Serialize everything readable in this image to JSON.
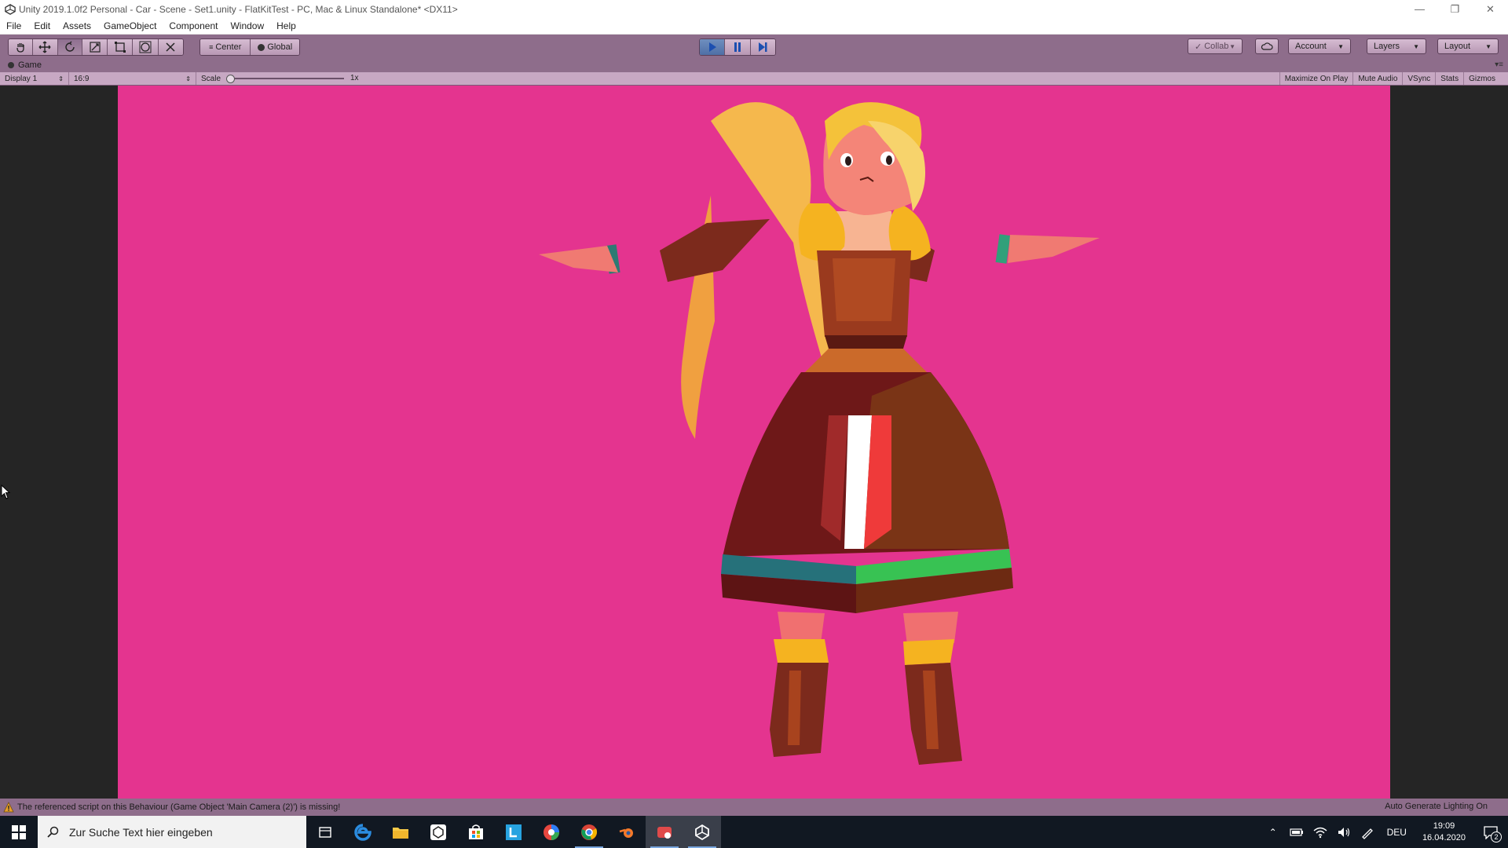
{
  "window": {
    "title": "Unity 2019.1.0f2 Personal - Car - Scene - Set1.unity - FlatKitTest - PC, Mac & Linux Standalone* <DX11>",
    "controls": [
      "minimize",
      "restore",
      "close"
    ]
  },
  "menu": {
    "items": [
      "File",
      "Edit",
      "Assets",
      "GameObject",
      "Component",
      "Window",
      "Help"
    ]
  },
  "toolbar": {
    "tools": [
      "hand-tool",
      "move-tool",
      "rotate-tool",
      "scale-tool",
      "rect-tool",
      "transform-tool",
      "custom-tool"
    ],
    "pivot_mode": "Center",
    "pivot_rotation": "Global",
    "play_state": "playing",
    "collab_label": "Collab",
    "account_label": "Account",
    "layers_label": "Layers",
    "layout_label": "Layout"
  },
  "game_tab": {
    "label": "Game"
  },
  "game_bar": {
    "display": "Display 1",
    "aspect": "16:9",
    "scale_label": "Scale",
    "scale_value": "1x",
    "maximize_on_play": "Maximize On Play",
    "mute_audio": "Mute Audio",
    "vsync": "VSync",
    "stats": "Stats",
    "gizmos": "Gizmos"
  },
  "viewport": {
    "background_color": "#e4348f"
  },
  "status": {
    "warning": "The referenced script on this Behaviour (Game Object 'Main Camera (2)') is missing!",
    "right": "Auto Generate Lighting On"
  },
  "taskbar": {
    "search_placeholder": "Zur Suche Text hier eingeben",
    "apps": [
      "task-view",
      "edge",
      "file-explorer",
      "unity-hub",
      "store",
      "app-l",
      "app-colorful",
      "chrome",
      "blender",
      "app-red",
      "unity"
    ],
    "language": "DEU",
    "time": "19:09",
    "date": "16.04.2020",
    "notification_count": "2"
  }
}
